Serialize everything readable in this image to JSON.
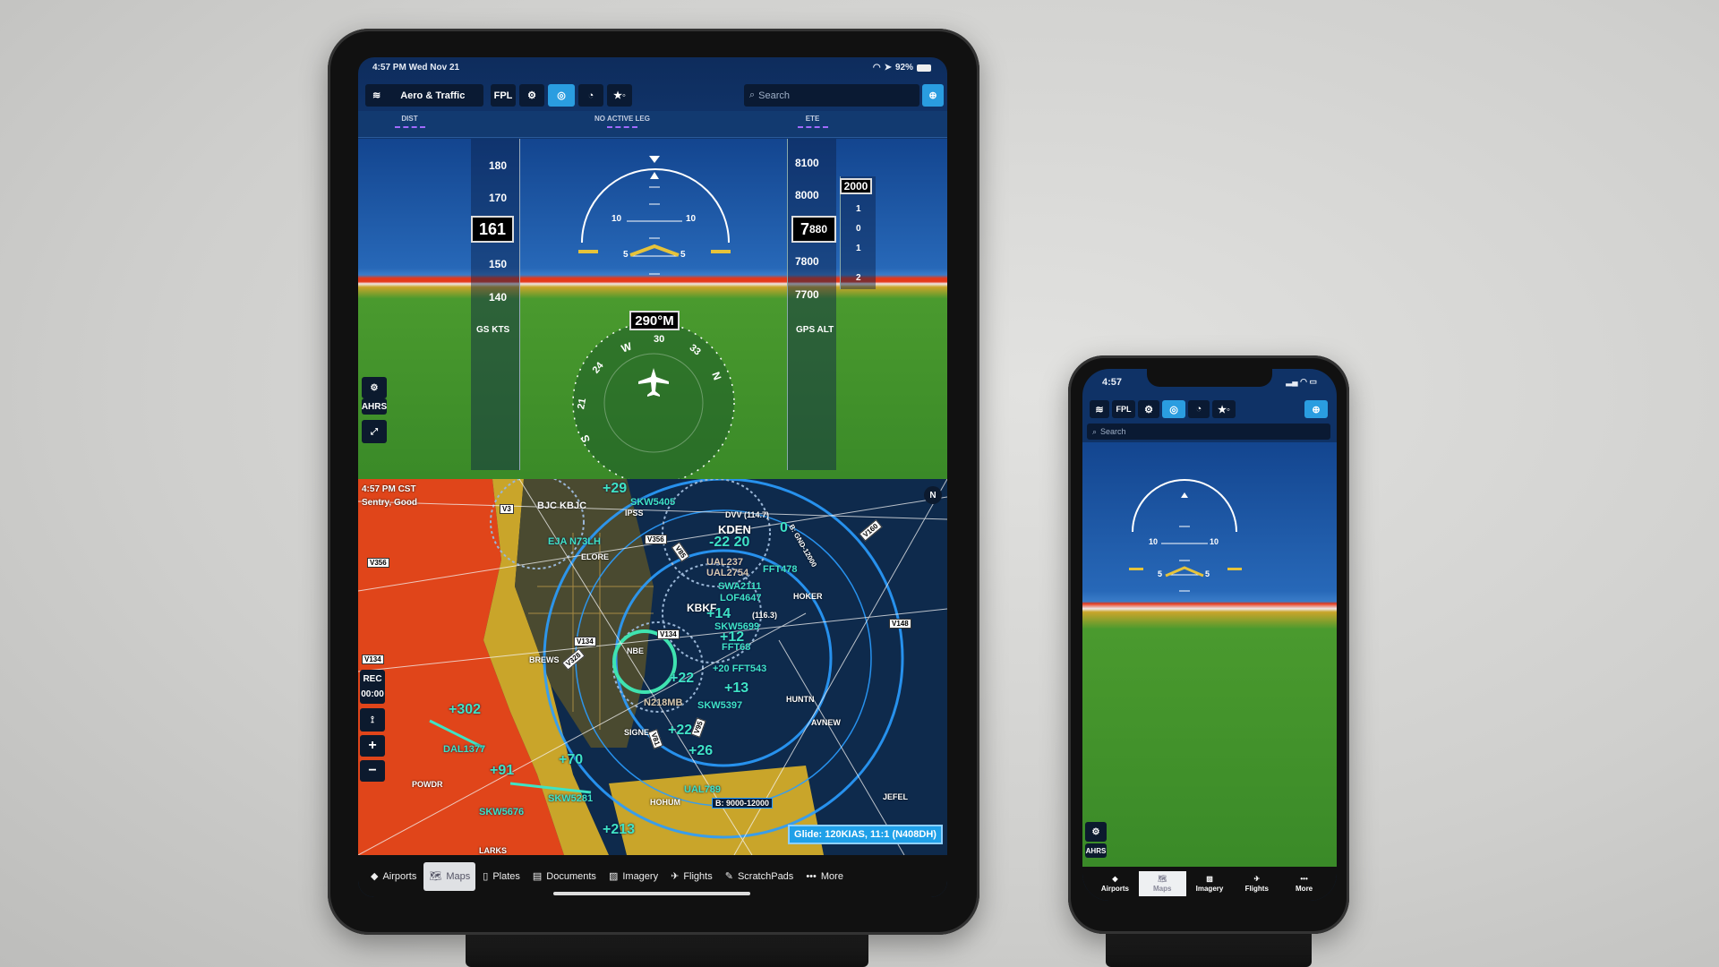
{
  "tablet": {
    "status": {
      "time": "4:57 PM  Wed Nov 21",
      "battery": "92%"
    },
    "toolbar": {
      "layer": "Aero & Traffic",
      "fpl": "FPL",
      "search_placeholder": "Search"
    },
    "nav": {
      "dist": "DIST",
      "leg": "NO ACTIVE LEG",
      "ete": "ETE"
    },
    "sv": {
      "speed_ticks": [
        "180",
        "170",
        "150",
        "140"
      ],
      "speed": "161",
      "speed_label": "GS KTS",
      "alt_ticks": [
        "8100",
        "8000",
        "7800",
        "7700"
      ],
      "alt_big": "7",
      "alt_small": "880",
      "alt_label": "GPS ALT",
      "vsi_top": "2000",
      "vsi_ticks": [
        "1",
        "0",
        "1",
        "2"
      ],
      "pitch": {
        "p10l": "10",
        "p10r": "10",
        "p5l": "5",
        "p5r": "5"
      },
      "heading": "290°M",
      "compass": [
        "W",
        "30",
        "33",
        "N",
        "24",
        "21",
        "S"
      ],
      "ahrs": "AHRS"
    },
    "map": {
      "time": "4:57 PM CST",
      "sentry": "Sentry, Good",
      "north": "N",
      "rec": "REC",
      "rec_time": "00:00",
      "labels": [
        "V3",
        "V356",
        "BJC KBJC",
        "+29",
        "SKW5405",
        "IPSS",
        "EJA N73LH",
        "ELORE",
        "V356",
        "V85",
        "DVV (114.7)",
        "KDEN",
        "0",
        "-22 20",
        "UAL237",
        "UAL2754",
        "FFT478",
        "SWA2111",
        "LOF4647",
        "HOKER",
        "KBKF",
        "+14",
        "(116.3)",
        "SKW5699",
        "+12",
        "FFT68",
        "V148",
        "V160",
        "V134",
        "V134",
        "V134",
        "BREWS",
        "V328",
        "NBE",
        "+20 FFT543",
        "+22",
        "+13",
        "SKW5397",
        "N218MB",
        "HUNTN",
        "AVNEW",
        "SIGNE",
        "+22",
        "+302",
        "DAL1377",
        "+26",
        "+70",
        "+91",
        "POWDR",
        "SKW5281",
        "UAL789",
        "SKW5676",
        "HOHUM",
        "B: 9000-12000",
        "JEFEL",
        "+213",
        "LARKS",
        "B: GND-12000",
        "V81",
        "V95"
      ],
      "glide": "Glide: 120KIAS, 11:1 (N408DH)"
    },
    "tabs": [
      {
        "label": "Airports",
        "icon": "airport-diamond"
      },
      {
        "label": "Maps",
        "icon": "map"
      },
      {
        "label": "Plates",
        "icon": "plate"
      },
      {
        "label": "Documents",
        "icon": "document"
      },
      {
        "label": "Imagery",
        "icon": "imagery"
      },
      {
        "label": "Flights",
        "icon": "plane-departure"
      },
      {
        "label": "ScratchPads",
        "icon": "pencil"
      },
      {
        "label": "More",
        "icon": "dots"
      }
    ],
    "selected_tab": "Maps"
  },
  "phone": {
    "status": {
      "time": "4:57"
    },
    "toolbar": {
      "fpl": "FPL",
      "search_placeholder": "Search"
    },
    "sv": {
      "p10l": "10",
      "p10r": "10",
      "p5l": "5",
      "p5r": "5",
      "ahrs": "AHRS"
    },
    "tabs": [
      {
        "label": "Airports"
      },
      {
        "label": "Maps"
      },
      {
        "label": "Imagery"
      },
      {
        "label": "Flights"
      },
      {
        "label": "More"
      }
    ],
    "selected_tab": "Maps"
  },
  "colors": {
    "accent": "#2a9de0",
    "traffic": "#3fe3c4",
    "airspace": "#1e8fff",
    "sky": "#1a4f9e",
    "ground": "#3a8a2a",
    "terrain_red": "#e03a12",
    "terrain_yellow": "#c9a52a"
  }
}
